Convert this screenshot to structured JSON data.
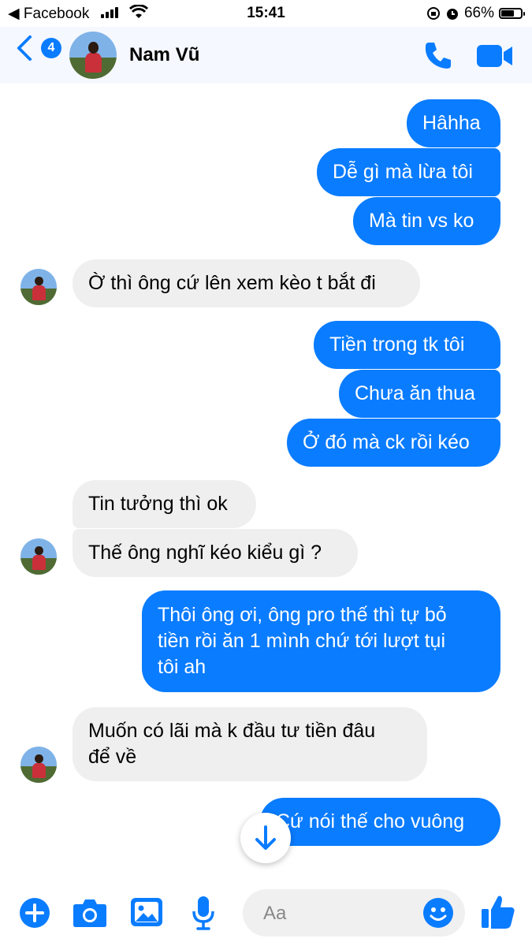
{
  "status_bar": {
    "back_app": "◀ Facebook",
    "time": "15:41",
    "battery": "66%"
  },
  "header": {
    "unread_count": "4",
    "contact_name": "Nam Vũ"
  },
  "messages": [
    {
      "text": "Hâhha"
    },
    {
      "text": "Dễ gì mà lừa tôi"
    },
    {
      "text": "Mà tin vs ko"
    },
    {
      "text": "Ờ thì ông cứ lên xem kèo t bắt đi"
    },
    {
      "text": "Tiền trong tk tôi"
    },
    {
      "text": "Chưa ăn thua"
    },
    {
      "text": "Ở đó mà ck rồi kéo"
    },
    {
      "text": "Tin tưởng thì ok"
    },
    {
      "text": "Thế ông nghĩ kéo kiểu gì ?"
    },
    {
      "text": "Thôi ông ơi, ông pro thế thì tự bỏ\ntiền rồi ăn 1 mình chứ tới lượt tụi\ntôi ah"
    },
    {
      "text": "Muốn có lãi mà k đầu tư tiền đâu\nđể về"
    },
    {
      "text": "Cứ nói thế cho vuông"
    }
  ],
  "composer": {
    "placeholder": "Aa"
  },
  "colors": {
    "accent": "#0a7cff",
    "incoming_bubble": "#efefef"
  },
  "icons": [
    "plus-icon",
    "camera-icon",
    "image-icon",
    "microphone-icon",
    "emoji-icon",
    "thumbs-up-icon",
    "phone-icon",
    "video-icon",
    "arrow-down-icon"
  ]
}
